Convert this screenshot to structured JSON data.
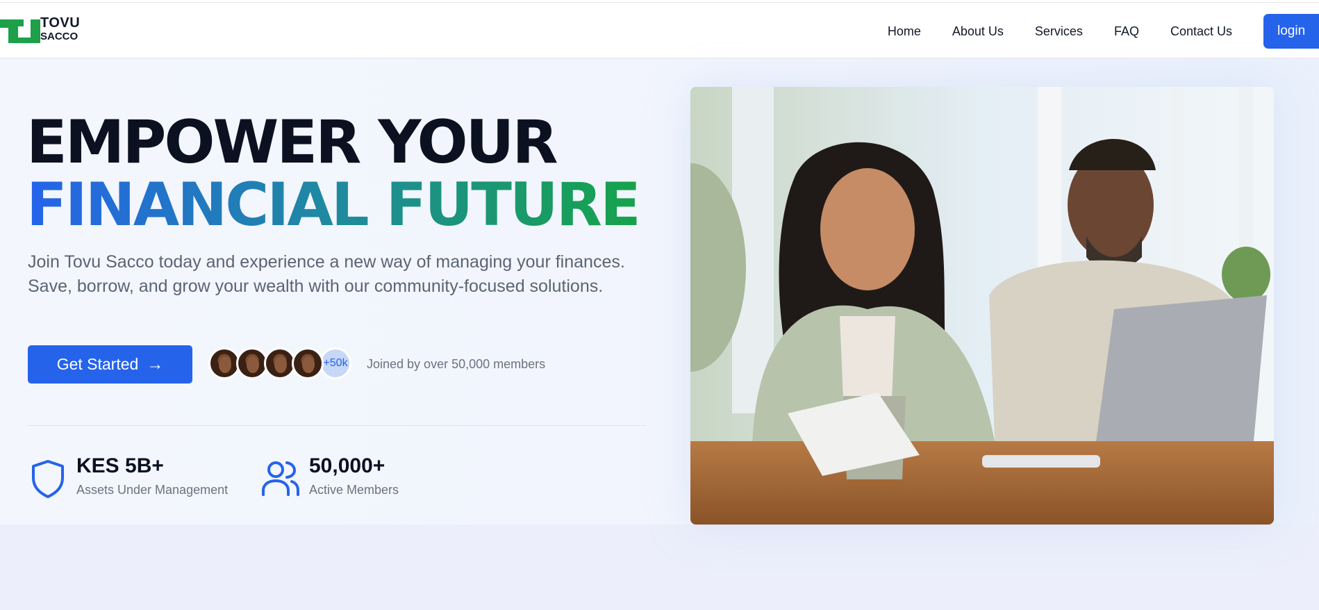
{
  "brand": {
    "line1": "TOVU",
    "line2": "SACCO",
    "green": "#16a34a"
  },
  "nav": {
    "items": [
      "Home",
      "About Us",
      "Services",
      "FAQ",
      "Contact Us"
    ],
    "login": "login"
  },
  "hero": {
    "headline_line1": "EMPOWER YOUR",
    "headline_line2": "FINANCIAL FUTURE",
    "subtitle": "Join Tovu Sacco today and experience a new way of managing your finances. Save, borrow, and grow your wealth with our community-focused solutions.",
    "cta_label": "Get Started",
    "avatar_more": "+50k",
    "joined_text": "Joined by over 50,000 members"
  },
  "stats": [
    {
      "value": "KES 5B+",
      "label": "Assets Under Management",
      "icon": "shield-icon"
    },
    {
      "value": "50,000+",
      "label": "Active Members",
      "icon": "users-icon"
    }
  ],
  "colors": {
    "accent": "#2563eb",
    "dark": "#0b1120",
    "muted": "#6b7280"
  }
}
